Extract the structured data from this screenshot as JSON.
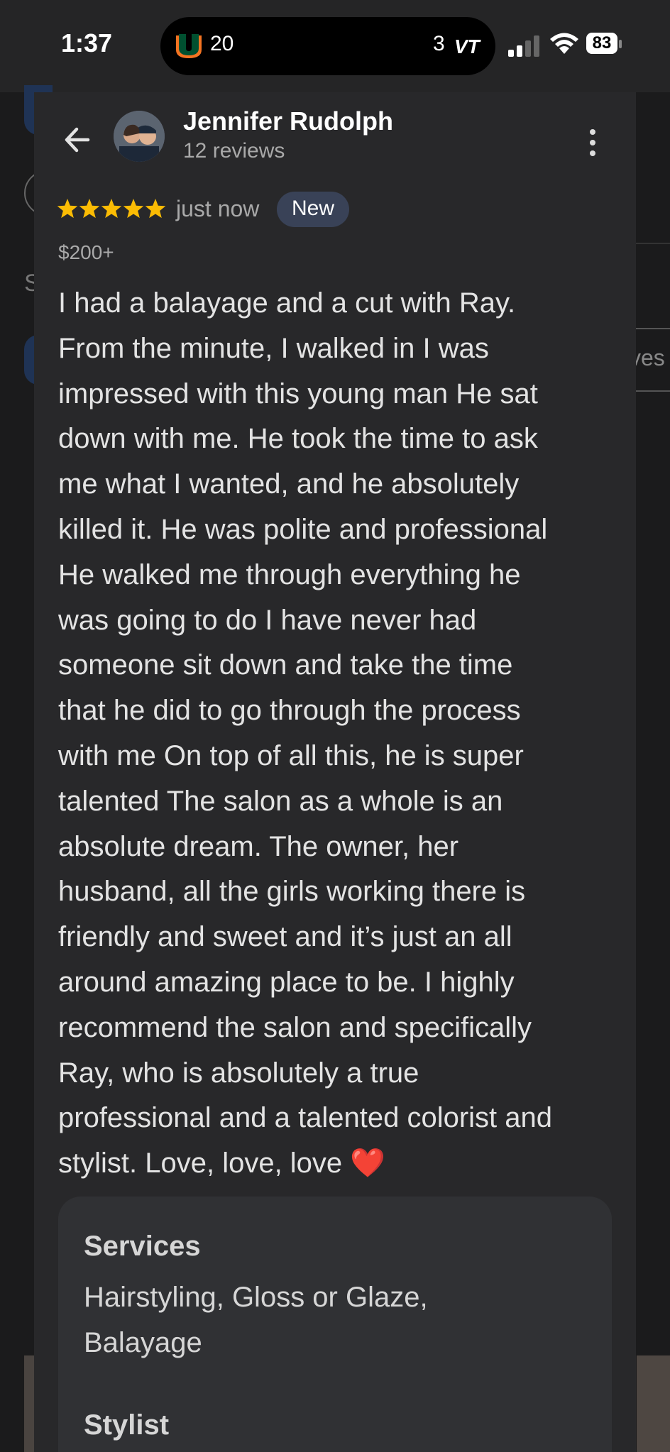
{
  "status_bar": {
    "time": "1:37",
    "score_left": "20",
    "score_right": "3",
    "right_team": "VT",
    "battery": "83"
  },
  "background": {
    "letter": "S",
    "tab_label": "ves"
  },
  "review": {
    "reviewer_name": "Jennifer Rudolph",
    "review_count": "12 reviews",
    "rating": 5,
    "time_ago": "just now",
    "badge": "New",
    "price": "$200+",
    "text_lines": [
      "I had a balayage and a cut with Ray.",
      "From the minute, I walked in I was",
      "impressed with this young man He sat",
      "down with me. He took the time to ask",
      "me what I wanted, and he absolutely",
      "killed it. He was polite and professional",
      "He walked me through everything he",
      "was going to do I have never had",
      "someone sit down and take the time",
      "that he did to go through the process",
      "with me On top of all this, he is super",
      "talented The salon as a whole is an",
      "absolute dream. The owner, her",
      "husband, all the girls working there is",
      "friendly and sweet and it’s just an all",
      "around amazing place to be. I highly",
      "recommend the salon and specifically",
      "Ray, who is absolutely a true",
      "professional and a talented colorist and",
      "stylist. Love, love, love ❤️"
    ],
    "services_label": "Services",
    "services_lines": [
      "Hairstyling, Gloss or Glaze,",
      "Balayage"
    ],
    "stylist_label": "Stylist"
  },
  "colors": {
    "star": "#fbbc04",
    "badge_bg": "#394257",
    "card_bg": "#28282a"
  },
  "icons": [
    "back-arrow-icon",
    "more-vert-icon",
    "star-icon",
    "wifi-icon",
    "signal-icon",
    "battery-icon"
  ]
}
